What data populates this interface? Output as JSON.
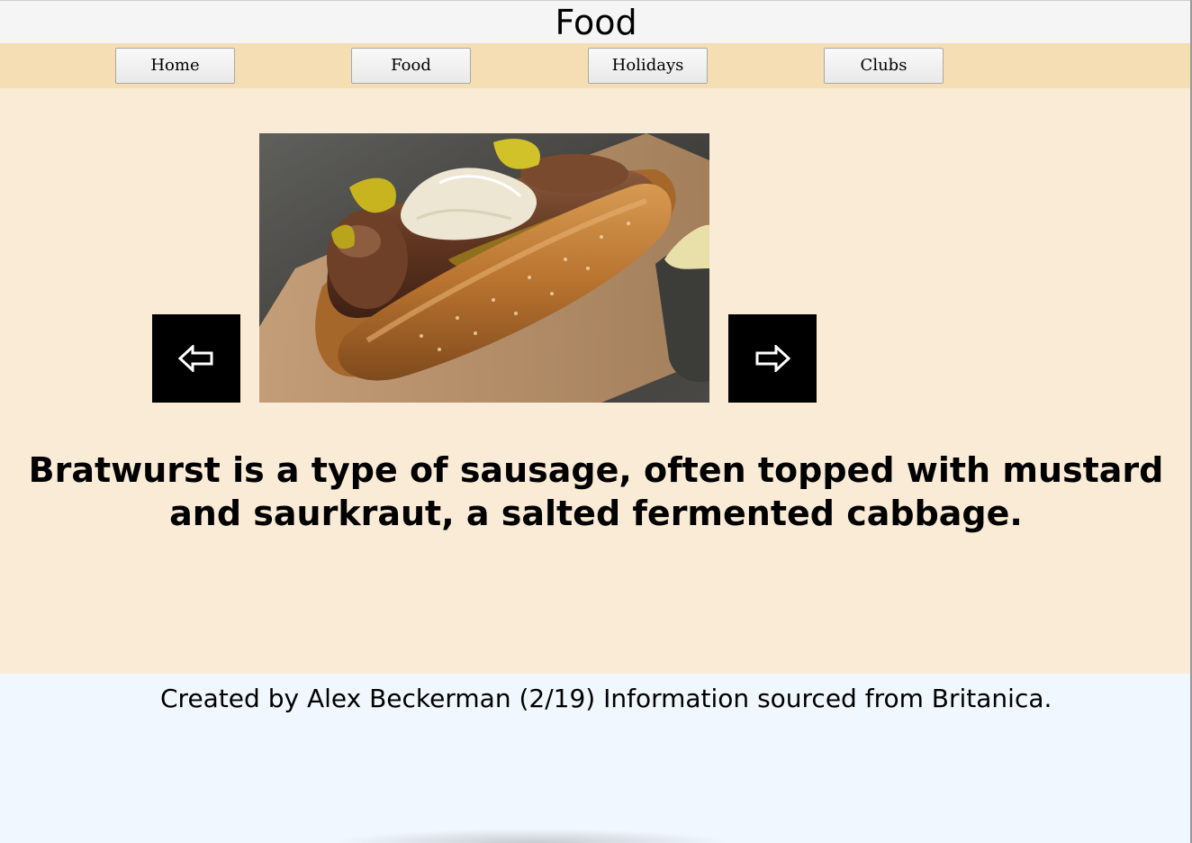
{
  "header": {
    "title": "Food"
  },
  "nav": {
    "items": [
      {
        "label": "Home"
      },
      {
        "label": "Food"
      },
      {
        "label": "Holidays"
      },
      {
        "label": "Clubs"
      }
    ]
  },
  "slideshow": {
    "prev_icon": "left-arrow-icon",
    "next_icon": "right-arrow-icon",
    "image_subject": "bratwurst-in-bun",
    "caption": "Bratwurst is a type of sausage, often topped with mustard and saurkraut, a salted fermented cabbage."
  },
  "footer": {
    "text": "Created by Alex Beckerman (2/19) Information sourced from Britanica."
  },
  "colors": {
    "nav_background": "#f5deb3",
    "content_background": "#faebd7",
    "footer_background": "#f1f7fe",
    "arrow_button": "#000000"
  }
}
